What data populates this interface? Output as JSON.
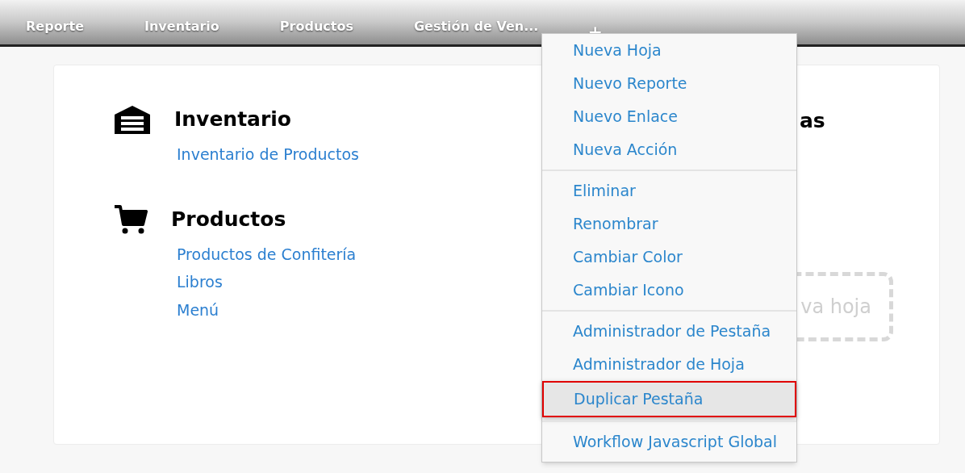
{
  "tabs": [
    {
      "label": "Reporte"
    },
    {
      "label": "Inventario"
    },
    {
      "label": "Productos"
    },
    {
      "label": "Gestión de Ven..."
    }
  ],
  "add_tab": "+",
  "sections": [
    {
      "kind": "warehouse",
      "title": "Inventario",
      "links": [
        "Inventario de Productos"
      ]
    },
    {
      "kind": "cart",
      "title": "Productos",
      "links": [
        "Productos de Confitería",
        "Libros",
        "Menú"
      ]
    }
  ],
  "hidden_heading": "as",
  "new_sheet_box": "va hoja",
  "menu": [
    [
      {
        "label": "Nueva Hoja",
        "selected": false
      },
      {
        "label": "Nuevo Reporte",
        "selected": false
      },
      {
        "label": "Nuevo Enlace",
        "selected": false
      },
      {
        "label": "Nueva Acción",
        "selected": false
      }
    ],
    [
      {
        "label": "Eliminar",
        "selected": false
      },
      {
        "label": "Renombrar",
        "selected": false
      },
      {
        "label": "Cambiar Color",
        "selected": false
      },
      {
        "label": "Cambiar Icono",
        "selected": false
      }
    ],
    [
      {
        "label": "Administrador de Pestaña",
        "selected": false
      },
      {
        "label": "Administrador de Hoja",
        "selected": false
      },
      {
        "label": "Duplicar Pestaña",
        "selected": true
      }
    ],
    [
      {
        "label": "Workflow Javascript Global",
        "selected": false
      }
    ]
  ]
}
